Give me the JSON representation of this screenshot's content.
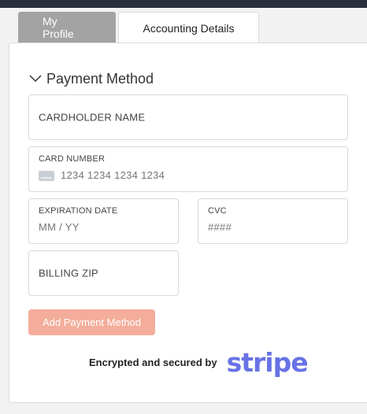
{
  "tabs": [
    {
      "label": "My Profile"
    },
    {
      "label": "Accounting Details"
    }
  ],
  "section": {
    "title": "Payment Method"
  },
  "fields": {
    "cardholder_name": {
      "label": "CARDHOLDER NAME"
    },
    "card_number": {
      "label": "CARD NUMBER",
      "placeholder": "1234 1234 1234 1234"
    },
    "expiration_date": {
      "label": "EXPIRATION DATE",
      "placeholder": "MM / YY"
    },
    "cvc": {
      "label": "CVC",
      "placeholder": "####"
    },
    "billing_zip": {
      "label": "BILLING ZIP"
    }
  },
  "add_button": {
    "label": "Add Payment Method"
  },
  "secure": {
    "text": "Encrypted and secured by",
    "brand": "stripe"
  },
  "colors": {
    "accent": "#f4ad9b",
    "brand": "#6772e5",
    "active_tab": "#a3a3a3",
    "top_bar": "#2b2e3b"
  }
}
